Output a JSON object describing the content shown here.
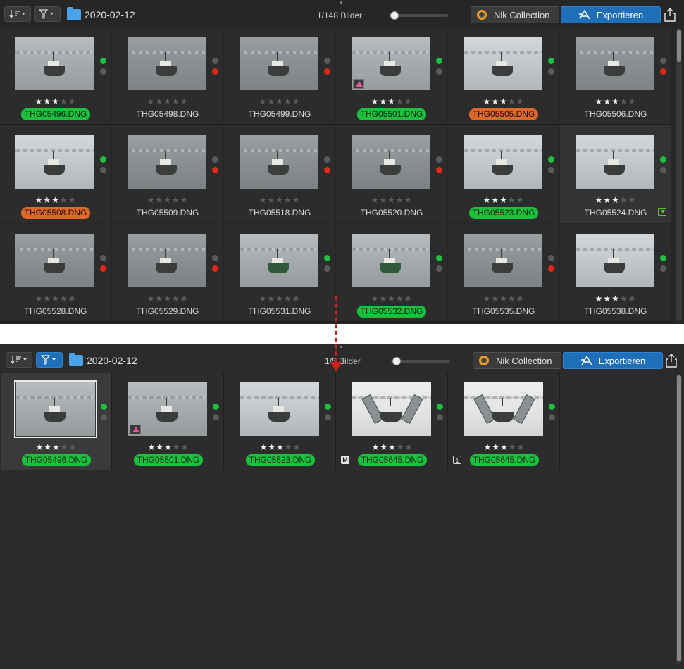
{
  "top_panel": {
    "toolbar": {
      "sort_icon": "sort-lines-icon",
      "filter_icon": "funnel-icon",
      "folder": "2020-02-12",
      "count": "1/148 Bilder",
      "slider_value": 0.1,
      "nik_label": "Nik Collection",
      "export_label": "Exportieren"
    },
    "rows": [
      [
        {
          "name": "THG05496.DNG",
          "stars": 3,
          "label": "green",
          "dot1": "green",
          "dot2": "gray",
          "tone": "normal"
        },
        {
          "name": "THG05498.DNG",
          "stars": 0,
          "label": "",
          "dot1": "gray",
          "dot2": "red",
          "tone": "dark"
        },
        {
          "name": "THG05499.DNG",
          "stars": 0,
          "label": "",
          "dot1": "gray",
          "dot2": "red",
          "tone": "dark"
        },
        {
          "name": "THG05501.DNG",
          "stars": 3,
          "label": "green",
          "dot1": "green",
          "dot2": "gray",
          "tone": "normal",
          "color_badge": true
        },
        {
          "name": "THG05505.DNG",
          "stars": 3,
          "label": "orange",
          "dot1": "green",
          "dot2": "gray",
          "tone": "bright"
        },
        {
          "name": "THG05506.DNG",
          "stars": 3,
          "label": "",
          "dot1": "gray",
          "dot2": "red",
          "tone": "dark"
        }
      ],
      [
        {
          "name": "THG05508.DNG",
          "stars": 3,
          "label": "orange",
          "dot1": "green",
          "dot2": "gray",
          "tone": "bright"
        },
        {
          "name": "THG05509.DNG",
          "stars": 0,
          "label": "",
          "dot1": "gray",
          "dot2": "red",
          "tone": "dark"
        },
        {
          "name": "THG05518.DNG",
          "stars": 0,
          "label": "",
          "dot1": "gray",
          "dot2": "red",
          "tone": "dark"
        },
        {
          "name": "THG05520.DNG",
          "stars": 0,
          "label": "",
          "dot1": "gray",
          "dot2": "red",
          "tone": "dark"
        },
        {
          "name": "THG05523.DNG",
          "stars": 3,
          "label": "green",
          "dot1": "green",
          "dot2": "gray",
          "tone": "bright"
        },
        {
          "name": "THG05524.DNG",
          "stars": 3,
          "label": "",
          "dot1": "green",
          "dot2": "gray",
          "tone": "bright",
          "download": true
        }
      ],
      [
        {
          "name": "THG05528.DNG",
          "stars": 0,
          "label": "",
          "dot1": "gray",
          "dot2": "red",
          "tone": "dark"
        },
        {
          "name": "THG05529.DNG",
          "stars": 0,
          "label": "",
          "dot1": "gray",
          "dot2": "red",
          "tone": "dark"
        },
        {
          "name": "THG05531.DNG",
          "stars": 0,
          "label": "",
          "dot1": "green",
          "dot2": "gray",
          "tone": "normal",
          "boat": "green"
        },
        {
          "name": "THG05532.DNG",
          "stars": 0,
          "label": "green",
          "dot1": "green",
          "dot2": "gray",
          "tone": "normal",
          "boat": "green"
        },
        {
          "name": "THG05535.DNG",
          "stars": 0,
          "label": "",
          "dot1": "gray",
          "dot2": "red",
          "tone": "dark"
        },
        {
          "name": "THG05538.DNG",
          "stars": 3,
          "label": "",
          "dot1": "green",
          "dot2": "gray",
          "tone": "bright"
        }
      ]
    ]
  },
  "bottom_panel": {
    "toolbar": {
      "folder": "2020-02-12",
      "count": "1/5 Bilder",
      "slider_value": 0.1,
      "nik_label": "Nik Collection",
      "export_label": "Exportieren"
    },
    "items": [
      {
        "name": "THG05496.DNG",
        "stars": 3,
        "label": "green",
        "dot1": "green",
        "dot2": "gray",
        "tone": "normal",
        "selected": true
      },
      {
        "name": "THG05501.DNG",
        "stars": 3,
        "label": "green",
        "dot1": "green",
        "dot2": "gray",
        "tone": "normal",
        "color_badge": true
      },
      {
        "name": "THG05523.DNG",
        "stars": 3,
        "label": "green",
        "dot1": "green",
        "dot2": "gray",
        "tone": "bright"
      },
      {
        "name": "THG05645.DNG",
        "stars": 3,
        "label": "green",
        "dot1": "green",
        "dot2": "gray",
        "tone": "bw",
        "nets": true,
        "badge": "M"
      },
      {
        "name": "THG05645.DNG",
        "stars": 3,
        "label": "green",
        "dot1": "green",
        "dot2": "gray",
        "tone": "bw",
        "nets": true,
        "badge": "1"
      }
    ]
  },
  "colors": {
    "accent_blue": "#1f6fb8",
    "label_green": "#19c23d",
    "label_orange": "#e0692a",
    "reject_red": "#e2261b",
    "annotation_arrow": "#d0201b"
  }
}
